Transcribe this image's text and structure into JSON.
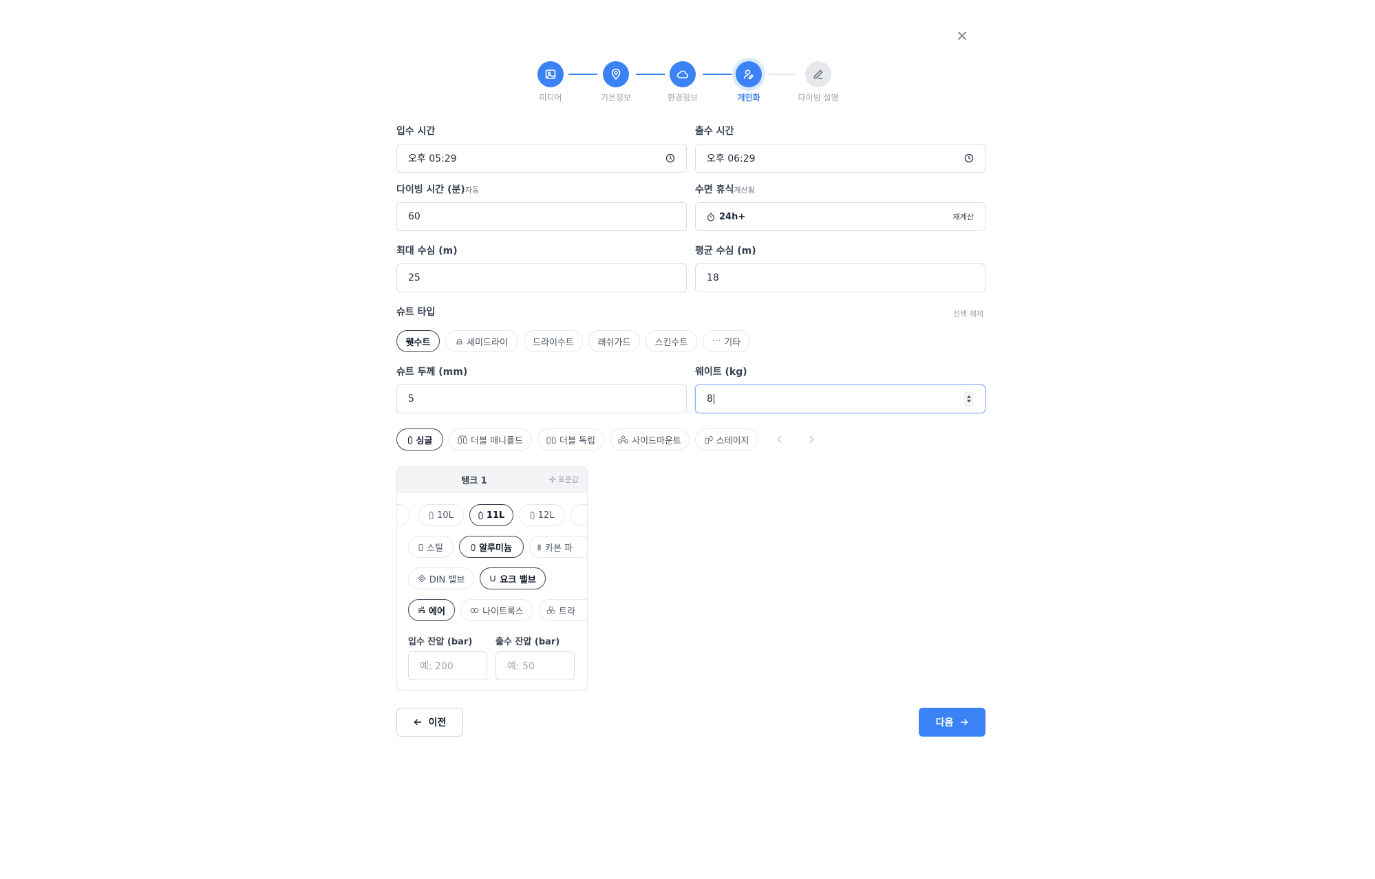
{
  "steps": [
    {
      "label": "미디어",
      "icon": "image-icon",
      "state": "done"
    },
    {
      "label": "기본정보",
      "icon": "map-pin-icon",
      "state": "done"
    },
    {
      "label": "환경정보",
      "icon": "cloud-icon",
      "state": "done"
    },
    {
      "label": "개인화",
      "icon": "user-edit-icon",
      "state": "current"
    },
    {
      "label": "다이빙 설명",
      "icon": "pencil-icon",
      "state": "pending"
    }
  ],
  "form": {
    "entry_time": {
      "label": "입수 시간",
      "value": "오후 05:29"
    },
    "exit_time": {
      "label": "출수 시간",
      "value": "오후 06:29"
    },
    "dive_time": {
      "label": "다이빙 시간 (분)",
      "sub": "자동",
      "value": "60"
    },
    "surface_interval": {
      "label": "수면 휴식",
      "sub": "계산됨",
      "value": "24h+",
      "action": "재계산"
    },
    "max_depth": {
      "label": "최대 수심 (m)",
      "value": "25"
    },
    "avg_depth": {
      "label": "평균 수심 (m)",
      "value": "18"
    },
    "suit_type": {
      "label": "슈트 타입",
      "clear": "선택 해제",
      "options": [
        "웻수트",
        "세미드라이",
        "드라이수트",
        "래쉬가드",
        "스킨수트",
        "기타"
      ],
      "selected": "웻수트"
    },
    "suit_thickness": {
      "label": "슈트 두께 (mm)",
      "value": "5"
    },
    "weight": {
      "label": "웨이트 (kg)",
      "value": "8"
    },
    "tank_config": {
      "options": [
        "싱글",
        "더블 매니폴드",
        "더블 독립",
        "사이드마운트",
        "스테이지"
      ],
      "selected": "싱글"
    }
  },
  "tank": {
    "title": "탱크 1",
    "preset": "표준값",
    "sizes": [
      "10L",
      "11L",
      "12L"
    ],
    "selected_size": "11L",
    "materials": [
      "스틸",
      "알루미늄",
      "카본 파"
    ],
    "selected_material": "알루미늄",
    "valves": [
      "DIN 밸브",
      "요크 밸브"
    ],
    "selected_valve": "요크 밸브",
    "gases": [
      "에어",
      "나이트록스",
      "트라"
    ],
    "selected_gas": "에어",
    "start_pressure": {
      "label": "입수 잔압 (bar)",
      "placeholder": "예: 200"
    },
    "end_pressure": {
      "label": "출수 잔압 (bar)",
      "placeholder": "예: 50"
    }
  },
  "nav": {
    "prev": "이전",
    "next": "다음"
  },
  "colors": {
    "accent": "#3b82f6",
    "border": "#d9dde3"
  }
}
